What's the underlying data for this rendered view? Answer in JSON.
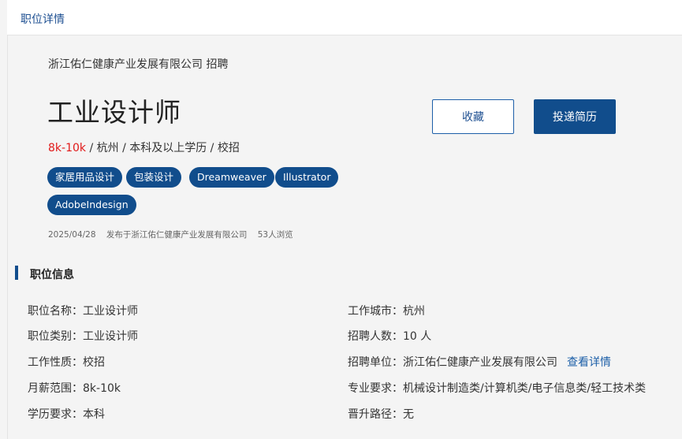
{
  "header": {
    "title": "职位详情"
  },
  "job": {
    "company_line": "浙江佑仁健康产业发展有限公司 招聘",
    "title": "工业设计师",
    "salary": "8k-10k",
    "summary_rest": " / 杭州 / 本科及以上学历 / 校招",
    "tags": [
      "家居用品设计",
      "包装设计",
      "Dreamweaver",
      "Illustrator",
      "AdobeIndesign"
    ],
    "publish_date": "2025/04/28",
    "publisher": "发布于浙江佑仁健康产业发展有限公司",
    "views": "53人浏览"
  },
  "actions": {
    "favorite_label": "收藏",
    "apply_label": "投递简历"
  },
  "section": {
    "title": "职位信息"
  },
  "info": {
    "left": [
      {
        "label": "职位名称：",
        "value": "工业设计师"
      },
      {
        "label": "职位类别：",
        "value": "工业设计师"
      },
      {
        "label": "工作性质：",
        "value": "校招"
      },
      {
        "label": "月薪范围：",
        "value": "8k-10k"
      },
      {
        "label": "学历要求：",
        "value": "本科"
      }
    ],
    "right": [
      {
        "label": "工作城市：",
        "value": "杭州"
      },
      {
        "label": "招聘人数：",
        "value": "10 人"
      },
      {
        "label": "招聘单位：",
        "value": "浙江佑仁健康产业发展有限公司",
        "link": "查看详情"
      },
      {
        "label": "专业要求：",
        "value": "机械设计制造类/计算机类/电子信息类/轻工技术类"
      },
      {
        "label": "晋升路径：",
        "value": "无"
      }
    ]
  }
}
